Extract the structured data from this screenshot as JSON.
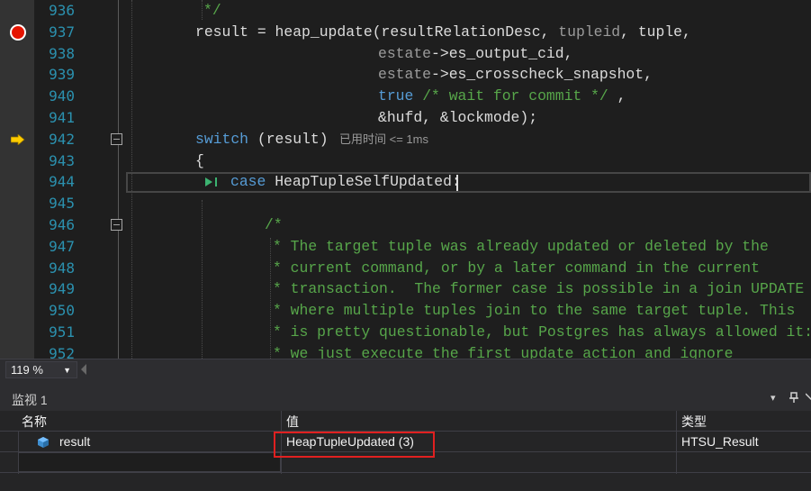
{
  "editor": {
    "lines": [
      {
        "number": "936",
        "tokens": [
          {
            "t": "*/",
            "c": "comment"
          }
        ]
      },
      {
        "number": "937",
        "tokens": [
          {
            "t": "result = heap_update(resultRelationDesc, ",
            "c": "plain"
          },
          {
            "t": "tupleid",
            "c": "gray"
          },
          {
            "t": ", tuple,",
            "c": "plain"
          }
        ]
      },
      {
        "number": "938",
        "tokens": [
          {
            "t": "estate",
            "c": "gray"
          },
          {
            "t": "->es_output_cid,",
            "c": "plain"
          }
        ]
      },
      {
        "number": "939",
        "tokens": [
          {
            "t": "estate",
            "c": "gray"
          },
          {
            "t": "->es_crosscheck_snapshot,",
            "c": "plain"
          }
        ]
      },
      {
        "number": "940",
        "tokens": [
          {
            "t": "true",
            "c": "kw"
          },
          {
            "t": " /* wait for commit */",
            "c": "comment"
          },
          {
            "t": " ,",
            "c": "plain"
          }
        ]
      },
      {
        "number": "941",
        "tokens": [
          {
            "t": "&hufd, &lockmode);",
            "c": "plain"
          }
        ]
      },
      {
        "number": "942",
        "tokens": [
          {
            "t": "switch",
            "c": "kw"
          },
          {
            "t": " (result)",
            "c": "plain"
          }
        ]
      },
      {
        "number": "943",
        "tokens": [
          {
            "t": "{",
            "c": "plain"
          }
        ]
      },
      {
        "number": "944",
        "tokens": [
          {
            "t": "case",
            "c": "kw"
          },
          {
            "t": " HeapTupleSelfUpdated:",
            "c": "plain"
          }
        ]
      },
      {
        "number": "945",
        "tokens": []
      },
      {
        "number": "946",
        "tokens": [
          {
            "t": "/*",
            "c": "comment"
          }
        ]
      },
      {
        "number": "947",
        "tokens": [
          {
            "t": "* The target tuple was already updated or deleted by the",
            "c": "comment"
          }
        ]
      },
      {
        "number": "948",
        "tokens": [
          {
            "t": "* current command, or by a later command in the current",
            "c": "comment"
          }
        ]
      },
      {
        "number": "949",
        "tokens": [
          {
            "t": "* transaction.  The former case is possible in a join UPDATE",
            "c": "comment"
          }
        ]
      },
      {
        "number": "950",
        "tokens": [
          {
            "t": "* where multiple tuples join to the same target tuple. This",
            "c": "comment"
          }
        ]
      },
      {
        "number": "951",
        "tokens": [
          {
            "t": "* is pretty questionable, but Postgres has always allowed it:",
            "c": "comment"
          }
        ]
      },
      {
        "number": "952",
        "tokens": [
          {
            "t": "* we just execute the first update action and ignore",
            "c": "comment"
          }
        ]
      }
    ],
    "perf_tip": "已用时间 <= 1ms",
    "breakpoint_line": "937",
    "current_line": "942",
    "icons": {
      "breakpoint": "breakpoint-icon",
      "execution_pointer": "execution-arrow-icon",
      "run_to_cursor": "run-to-cursor-icon",
      "collapse": "collapse-icon"
    },
    "colors": {
      "line_number": "#2b91af",
      "keyword": "#569cd6",
      "comment": "#57a64a",
      "breakpoint": "#e51400",
      "execution_arrow": "#ffcc00"
    }
  },
  "zoom": {
    "value": "119 %"
  },
  "watch": {
    "title": "监视 1",
    "columns": {
      "name": "名称",
      "value": "值",
      "type": "类型"
    },
    "rows": [
      {
        "name": "result",
        "value": "HeapTupleUpdated (3)",
        "type": "HTSU_Result"
      }
    ],
    "highlight_color": "#e02020",
    "buttons": {
      "dropdown": "▾",
      "pin": "📌",
      "close": "✕"
    }
  }
}
